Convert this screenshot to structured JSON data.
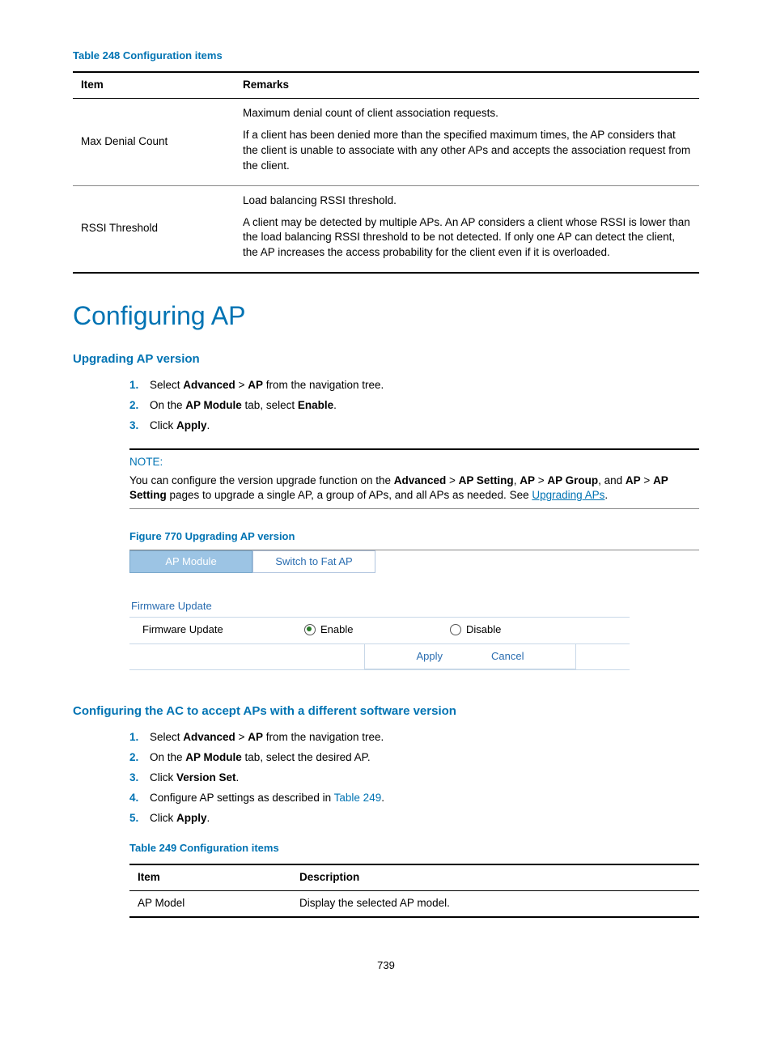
{
  "table248": {
    "caption": "Table 248 Configuration items",
    "headers": {
      "item": "Item",
      "remarks": "Remarks"
    },
    "rows": [
      {
        "item": "Max Denial Count",
        "p1": "Maximum denial count of client association requests.",
        "p2": "If a client has been denied more than the specified maximum times, the AP considers that the client is unable to associate with any other APs and accepts the association request from the client."
      },
      {
        "item": "RSSI Threshold",
        "p1": "Load balancing RSSI threshold.",
        "p2": "A client may be detected by multiple APs. An AP considers a client whose RSSI is lower than the load balancing RSSI threshold to be not detected. If only one AP can detect the client, the AP increases the access probability for the client even if it is overloaded."
      }
    ]
  },
  "h1": "Configuring AP",
  "upgrading": {
    "title": "Upgrading AP version",
    "steps": {
      "s1_pre": "Select ",
      "s1_b1": "Advanced",
      "s1_mid": " > ",
      "s1_b2": "AP",
      "s1_post": " from the navigation tree.",
      "s2_pre": "On the ",
      "s2_b1": "AP Module",
      "s2_mid": " tab, select ",
      "s2_b2": "Enable",
      "s2_post": ".",
      "s3_pre": "Click ",
      "s3_b1": "Apply",
      "s3_post": "."
    }
  },
  "note": {
    "label": "NOTE:",
    "t1": "You can configure the version upgrade function on the ",
    "b1": "Advanced",
    "sep": " > ",
    "b2": "AP Setting",
    "c1": ", ",
    "b3": "AP",
    "b4": "AP Group",
    "c2": ", and ",
    "b5": "AP",
    "b6": "AP Setting",
    "t2": " pages to upgrade a single AP, a group of APs, and all APs as needed. See ",
    "link": "Upgrading APs",
    "t3": "."
  },
  "figure": {
    "caption": "Figure 770 Upgrading AP version",
    "tab_active": "AP Module",
    "tab_inactive": "Switch to Fat AP",
    "group": "Firmware Update",
    "row_label": "Firmware Update",
    "enable": "Enable",
    "disable": "Disable",
    "apply": "Apply",
    "cancel": "Cancel"
  },
  "accepting": {
    "title": "Configuring the AC to accept APs with a different software version",
    "steps": {
      "s1_pre": "Select ",
      "s1_b1": "Advanced",
      "s1_mid": " > ",
      "s1_b2": "AP",
      "s1_post": " from the navigation tree.",
      "s2_pre": "On the ",
      "s2_b1": "AP Module",
      "s2_post": " tab, select the desired AP.",
      "s3_pre": "Click ",
      "s3_b1": "Version Set",
      "s3_post": ".",
      "s4_pre": "Configure AP settings as described in ",
      "s4_link": "Table 249",
      "s4_post": ".",
      "s5_pre": "Click ",
      "s5_b1": "Apply",
      "s5_post": "."
    }
  },
  "table249": {
    "caption": "Table 249 Configuration items",
    "headers": {
      "item": "Item",
      "desc": "Description"
    },
    "row1": {
      "item": "AP Model",
      "desc": "Display the selected AP model."
    }
  },
  "page": "739"
}
